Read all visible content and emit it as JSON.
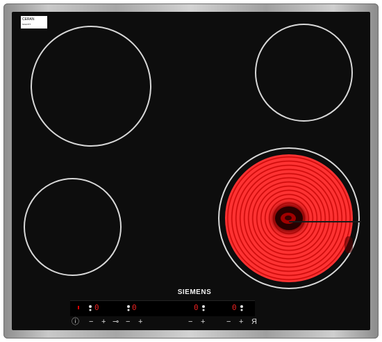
{
  "hob": {
    "brand": "SIEMENS",
    "ceran_logo": "CERAN",
    "ceran_subtext": "SCHOTT",
    "colors": {
      "frame": "#b5b5b5",
      "glass": "#0d0d0d",
      "hot_zone": "#ff2a2a",
      "display": "#e82020"
    },
    "zones": [
      {
        "name": "top-left",
        "state": "off"
      },
      {
        "name": "top-right",
        "state": "off"
      },
      {
        "name": "bottom-left",
        "state": "off"
      },
      {
        "name": "bottom-right",
        "state": "hot"
      }
    ]
  },
  "displays": {
    "d1": "0",
    "d2": "0",
    "d3": "0",
    "d4": "0"
  },
  "controls": {
    "power": "ⓘ",
    "minus": "−",
    "plus": "+",
    "lock": "⊸",
    "timer": "Я"
  }
}
